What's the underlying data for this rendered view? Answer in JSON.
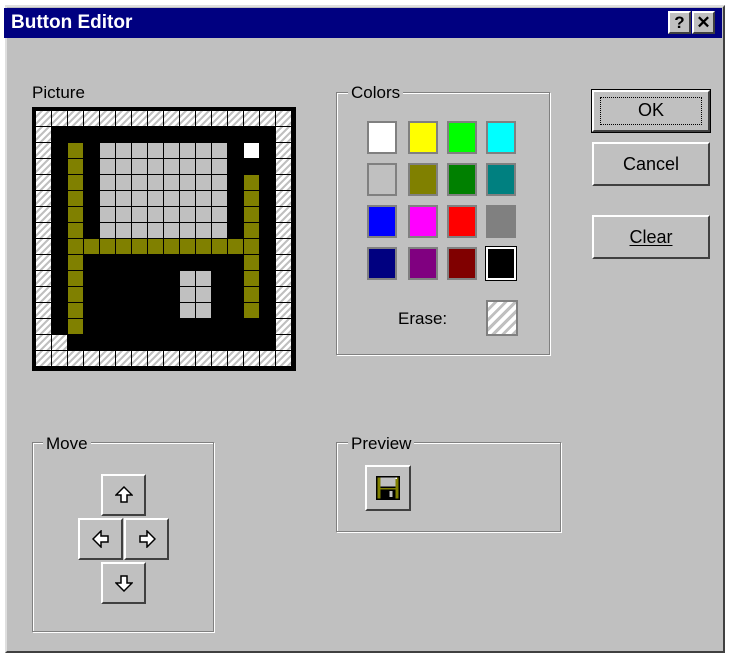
{
  "window": {
    "title": "Button Editor",
    "help_label": "?",
    "close_label": "✕"
  },
  "picture": {
    "label": "Picture",
    "rows": [
      "................",
      ".KKKKKKKKKKKKKK.",
      ".KOKGGGGGGGGKWK.",
      ".KOKGGGGGGGGKKK.",
      ".KOKGGGGGGGGKOK.",
      ".KOKGGGGGGGGKOK.",
      ".KOKGGGGGGGGKOK.",
      ".KOKGGGGGGGGKOK.",
      ".KOOOOOOOOOOOOK.",
      ".KOKKKKKKKKKKOK.",
      ".KOKKKKKKGGKKOK.",
      ".KOKKKKKKGGKKOK.",
      ".KOKKKKKKGGKKOK.",
      ".KOKKKKKKKKKKKK.",
      "..KKKKKKKKKKKKK.",
      "................"
    ],
    "palette": {
      "K": "#000000",
      "O": "#808000",
      "G": "#c0c0c0",
      "W": "#ffffff"
    }
  },
  "colors": {
    "label": "Colors",
    "swatches": [
      "#ffffff",
      "#ffff00",
      "#00ff00",
      "#00ffff",
      "#c0c0c0",
      "#808000",
      "#008000",
      "#008080",
      "#0000ff",
      "#ff00ff",
      "#ff0000",
      "#808080",
      "#000080",
      "#800080",
      "#800000",
      "#000000"
    ],
    "selected_index": 15,
    "erase_label": "Erase:"
  },
  "buttons": {
    "ok": "OK",
    "cancel": "Cancel",
    "clear": "Clear"
  },
  "move": {
    "label": "Move"
  },
  "preview": {
    "label": "Preview",
    "icon": "floppy-disk-icon"
  }
}
